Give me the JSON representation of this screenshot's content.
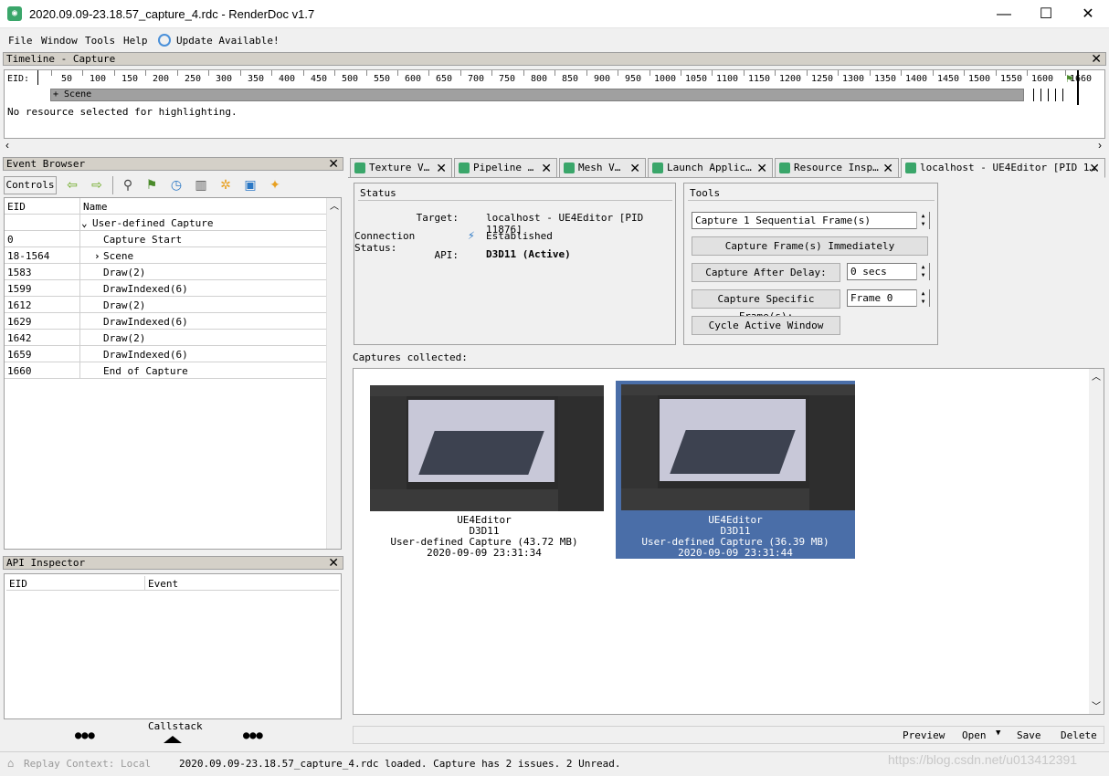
{
  "window": {
    "title": "2020.09.09-23.18.57_capture_4.rdc - RenderDoc v1.7",
    "minimize": "—",
    "maximize": "☐",
    "close": "✕"
  },
  "menu": {
    "file": "File",
    "window": "Window",
    "tools": "Tools",
    "help": "Help",
    "update": "Update Available!"
  },
  "timeline": {
    "title": "Timeline - Capture",
    "eid_label": "EID:",
    "ticks": [
      "50",
      "100",
      "150",
      "200",
      "250",
      "300",
      "350",
      "400",
      "450",
      "500",
      "550",
      "600",
      "650",
      "700",
      "750",
      "800",
      "850",
      "900",
      "950",
      "1000",
      "1050",
      "1100",
      "1150",
      "1200",
      "1250",
      "1300",
      "1350",
      "1400",
      "1450",
      "1500",
      "1550",
      "1600",
      "1660"
    ],
    "scene_label": "+ Scene",
    "highlight_text": "No resource selected for highlighting."
  },
  "event_browser": {
    "title": "Event Browser",
    "controls_label": "Controls",
    "col_eid": "EID",
    "col_name": "Name",
    "rows": [
      {
        "eid": "",
        "name": "User-defined Capture",
        "expander": "v"
      },
      {
        "eid": "0",
        "name": "Capture Start"
      },
      {
        "eid": "18-1564",
        "name": "Scene",
        "expander": ">"
      },
      {
        "eid": "1583",
        "name": "Draw(2)"
      },
      {
        "eid": "1599",
        "name": "DrawIndexed(6)"
      },
      {
        "eid": "1612",
        "name": "Draw(2)"
      },
      {
        "eid": "1629",
        "name": "DrawIndexed(6)"
      },
      {
        "eid": "1642",
        "name": "Draw(2)"
      },
      {
        "eid": "1659",
        "name": "DrawIndexed(6)"
      },
      {
        "eid": "1660",
        "name": "End of Capture"
      }
    ]
  },
  "api_inspector": {
    "title": "API Inspector",
    "col_eid": "EID",
    "col_event": "Event",
    "callstack": "Callstack",
    "dots": "●●●"
  },
  "tabs": [
    {
      "label": "Texture V…"
    },
    {
      "label": "Pipeline …"
    },
    {
      "label": "Mesh V…"
    },
    {
      "label": "Launch Applic…"
    },
    {
      "label": "Resource Insp…"
    },
    {
      "label": "localhost - UE4Editor [PID 1…"
    }
  ],
  "status": {
    "title": "Status",
    "target_label": "Target:",
    "target_value": "localhost - UE4Editor [PID 11876]",
    "conn_label": "Connection Status:",
    "conn_value": "Established",
    "api_label": "API:",
    "api_value": "D3D11 (Active)"
  },
  "tools": {
    "title": "Tools",
    "capture_frames_value": "Capture 1 Sequential Frame(s)",
    "capture_immediately": "Capture Frame(s) Immediately",
    "capture_after_delay": "Capture After Delay:",
    "delay_value": "0 secs",
    "capture_specific": "Capture Specific Frame(s):",
    "frame_value": "Frame 0",
    "cycle_window": "Cycle Active Window"
  },
  "captures": {
    "label": "Captures collected:",
    "items": [
      {
        "app": "UE4Editor",
        "api": "D3D11",
        "desc": "User-defined Capture (43.72 MB)",
        "time": "2020-09-09 23:31:34",
        "selected": false
      },
      {
        "app": "UE4Editor",
        "api": "D3D11",
        "desc": "User-defined Capture (36.39 MB)",
        "time": "2020-09-09 23:31:44",
        "selected": true
      }
    ]
  },
  "actions": {
    "preview": "Preview",
    "open": "Open",
    "save": "Save",
    "delete": "Delete"
  },
  "statusbar": {
    "replay": "Replay Context: Local",
    "message": "2020.09.09-23.18.57_capture_4.rdc loaded. Capture has 2 issues. 2 Unread.",
    "watermark": "https://blog.csdn.net/u013412391"
  },
  "colors": {
    "selection": "#4a6ea8",
    "accent_green": "#3aa66a"
  }
}
